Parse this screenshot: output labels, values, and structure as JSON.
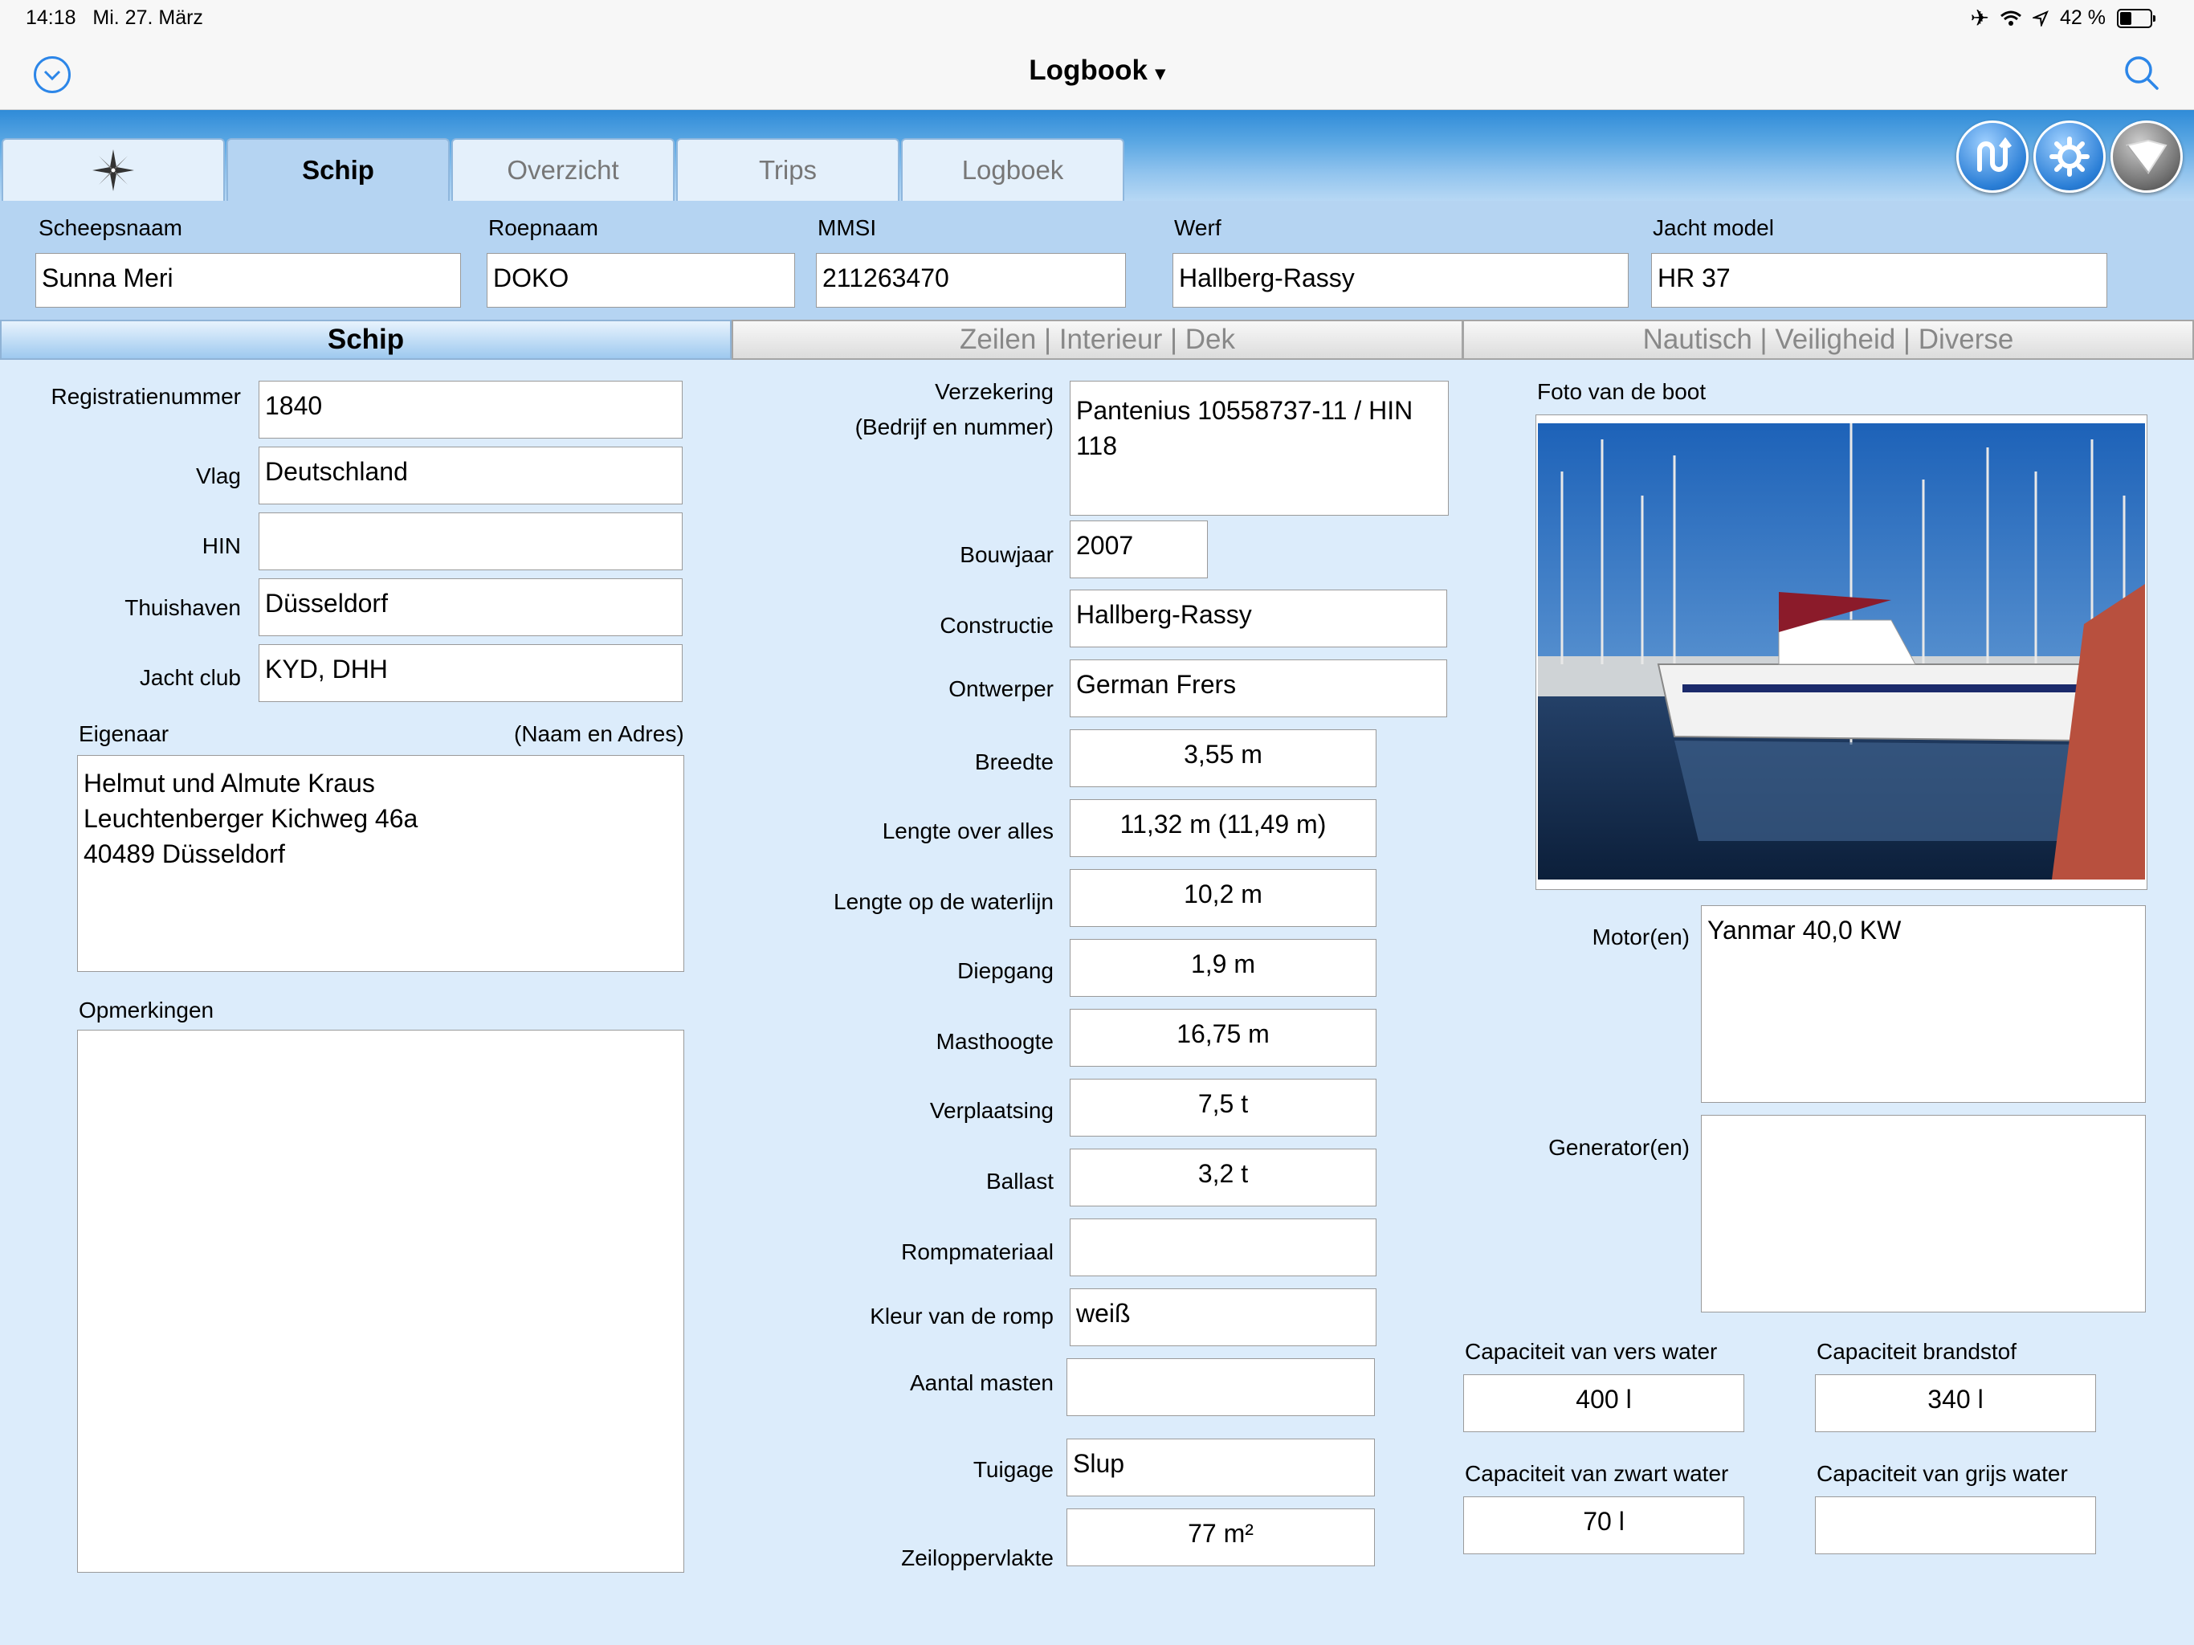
{
  "status": {
    "time": "14:18",
    "date": "Mi. 27. März",
    "battery": "42 %"
  },
  "nav": {
    "title": "Logbook",
    "title_caret": "▾"
  },
  "tabs": [
    {
      "label": ""
    },
    {
      "label": "Schip"
    },
    {
      "label": "Overzicht"
    },
    {
      "label": "Trips"
    },
    {
      "label": "Logboek"
    }
  ],
  "header": {
    "ship_name_label": "Scheepsnaam",
    "ship_name": "Sunna Meri",
    "callsign_label": "Roepnaam",
    "callsign": "DOKO",
    "mmsi_label": "MMSI",
    "mmsi": "211263470",
    "yard_label": "Werf",
    "yard": "Hallberg-Rassy",
    "model_label": "Jacht model",
    "model": "HR 37"
  },
  "segments": [
    {
      "label": "Schip"
    },
    {
      "label": "Zeilen | Interieur | Dek"
    },
    {
      "label": "Nautisch | Veiligheid | Diverse"
    }
  ],
  "left": {
    "reg_label": "Registratienummer",
    "reg": "1840",
    "flag_label": "Vlag",
    "flag": "Deutschland",
    "hin_label": "HIN",
    "hin": "",
    "home_label": "Thuishaven",
    "home": "Düsseldorf",
    "club_label": "Jacht club",
    "club": "KYD, DHH",
    "owner_label": "Eigenaar",
    "owner_hint": "(Naam en Adres)",
    "owner": "Helmut und Almute Kraus\nLeuchtenberger Kichweg 46a\n40489 Düsseldorf",
    "remarks_label": "Opmerkingen",
    "remarks": ""
  },
  "middle": {
    "insurance_label": "Verzekering",
    "insurance_hint": "(Bedrijf en nummer)",
    "insurance": "Pantenius 10558737-11 / HIN 118",
    "year_label": "Bouwjaar",
    "year": "2007",
    "construction_label": "Constructie",
    "construction": "Hallberg-Rassy",
    "designer_label": "Ontwerper",
    "designer": "German Frers",
    "beam_label": "Breedte",
    "beam": "3,55 m",
    "loa_label": "Lengte over alles",
    "loa": "11,32 m (11,49 m)",
    "lwl_label": "Lengte op de waterlijn",
    "lwl": "10,2 m",
    "draft_label": "Diepgang",
    "draft": "1,9 m",
    "mast_label": "Masthoogte",
    "mast": "16,75 m",
    "displacement_label": "Verplaatsing",
    "displacement": "7,5 t",
    "ballast_label": "Ballast",
    "ballast": "3,2 t",
    "hull_material_label": "Rompmateriaal",
    "hull_material": "",
    "hull_color_label": "Kleur van de romp",
    "hull_color": "weiß",
    "masts_label": "Aantal masten",
    "masts": "",
    "rig_label": "Tuigage",
    "rig": "Slup",
    "sail_area_label": "Zeiloppervlakte",
    "sail_area": "77 m²"
  },
  "right": {
    "photo_label": "Foto van de boot",
    "engine_label": "Motor(en)",
    "engine": "Yanmar 40,0 KW",
    "generator_label": "Generator(en)",
    "generator": "",
    "fresh_label": "Capaciteit van vers water",
    "fresh": "400 l",
    "fuel_label": "Capaciteit brandstof",
    "fuel": "340 l",
    "black_label": "Capaciteit van zwart water",
    "black": "70 l",
    "grey_label": "Capaciteit van grijs water",
    "grey": ""
  },
  "icons": {
    "nav_left": "chevron-down-circle-icon",
    "nav_right": "search-icon",
    "tab0": "compass-rose-icon",
    "btn1": "sync-icon",
    "btn2": "gear-icon",
    "btn3": "book-icon"
  }
}
